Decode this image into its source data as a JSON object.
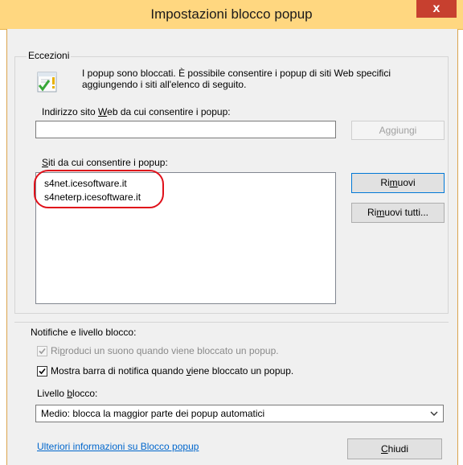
{
  "window": {
    "title": "Impostazioni blocco popup",
    "close_symbol": "x"
  },
  "exceptions": {
    "group_label": "Eccezioni",
    "intro_text_1": "I popup sono bloccati. È possibile consentire i popup di siti Web specifici",
    "intro_text_2": "aggiungendo i siti all'elenco di seguito.",
    "address_label_pre": "Indirizzo sito ",
    "address_label_key": "W",
    "address_label_post": "eb da cui consentire i popup:",
    "address_value": "",
    "add_button_label": "Aggiungi",
    "list_label_key": "S",
    "list_label_post": "iti da cui consentire i popup:",
    "sites": [
      "s4net.icesoftware.it",
      "s4neterp.icesoftware.it"
    ],
    "remove_button_pre": "Ri",
    "remove_button_key": "m",
    "remove_button_post": "uovi",
    "remove_all_button_pre": "Ri",
    "remove_all_button_key": "m",
    "remove_all_button_post": "uovi tutti..."
  },
  "notifications": {
    "group_label": "Notifiche e livello blocco:",
    "sound_pre": "Ri",
    "sound_key": "p",
    "sound_post": "roduci un suono quando viene bloccato un popup.",
    "sound_checked": true,
    "bar_pre": "Mostra barra di notifica quando ",
    "bar_key": "v",
    "bar_post": "iene bloccato un popup.",
    "bar_checked": true,
    "level_pre": "Livello ",
    "level_key": "b",
    "level_post": "locco:",
    "level_value": "Medio: blocca la maggior parte dei popup automatici",
    "more_info_link": "Ulteriori informazioni su Blocco popup",
    "close_pre": "",
    "close_key": "C",
    "close_post": "hiudi"
  },
  "colors": {
    "titlebar": "#ffd780",
    "close_button": "#c7402f",
    "highlight_ellipse": "#e0101a",
    "link": "#0066cc"
  },
  "icons": [
    "info-check-icon",
    "checkmark-icon",
    "chevron-down-icon",
    "close-icon"
  ]
}
